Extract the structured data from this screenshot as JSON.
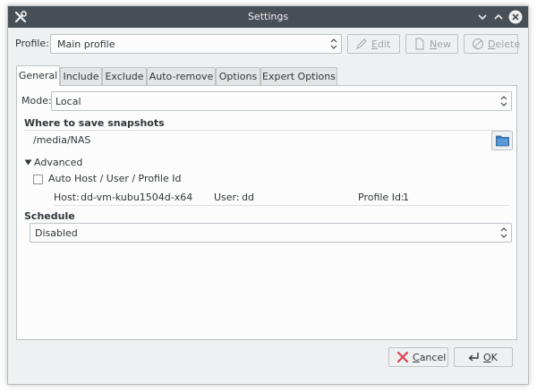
{
  "window": {
    "title": "Settings"
  },
  "profile": {
    "label": "Profile:",
    "value": "Main profile",
    "edit_label": "Edit",
    "new_label": "New",
    "delete_label": "Delete"
  },
  "tabs": [
    {
      "label": "General",
      "active": true
    },
    {
      "label": "Include",
      "active": false
    },
    {
      "label": "Exclude",
      "active": false
    },
    {
      "label": "Auto-remove",
      "active": false
    },
    {
      "label": "Options",
      "active": false
    },
    {
      "label": "Expert Options",
      "active": false
    }
  ],
  "general": {
    "mode_label": "Mode:",
    "mode_value": "Local",
    "where_heading": "Where to save snapshots",
    "path": "/media/NAS",
    "advanced_label": "Advanced",
    "auto_host_label": "Auto Host / User / Profile Id",
    "host_label": "Host:",
    "host_value": "dd-vm-kubu1504d-x64",
    "user_label": "User:",
    "user_value": "dd",
    "profile_id_label": "Profile Id:",
    "profile_id_value": "1",
    "schedule_heading": "Schedule",
    "schedule_value": "Disabled"
  },
  "footer": {
    "cancel_label": "Cancel",
    "ok_label": "OK"
  },
  "icons": {
    "app": "tools-icon",
    "folder": "folder-icon"
  },
  "colors": {
    "titlebar": "#475057",
    "window_bg": "#eff0f1",
    "panel_bg": "#fcfcfc",
    "folder_blue": "#3a7bbf",
    "cancel_red": "#da4453"
  }
}
